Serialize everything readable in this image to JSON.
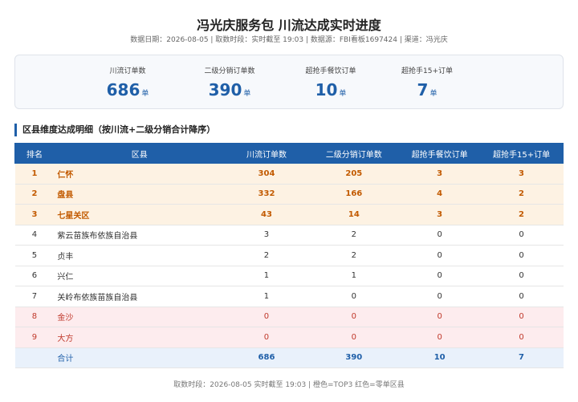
{
  "header": {
    "title": "冯光庆服务包 川流达成实时进度",
    "meta": "数据日期：2026-08-05 | 取数时段：实时截至 19:03 | 数据源：FBI看板1697424 | 渠道：冯光庆"
  },
  "kpis": [
    {
      "label": "川流订单数",
      "value": "686",
      "unit": "单"
    },
    {
      "label": "二级分销订单数",
      "value": "390",
      "unit": "单"
    },
    {
      "label": "超抢手餐饮订单",
      "value": "10",
      "unit": "单"
    },
    {
      "label": "超抢手15+订单",
      "value": "7",
      "unit": "单"
    }
  ],
  "section": {
    "title": "区县维度达成明细（按川流+二级分销合计降序）"
  },
  "table": {
    "columns": [
      "排名",
      "区县",
      "川流订单数",
      "二级分销订单数",
      "超抢手餐饮订单",
      "超抢手15+订单"
    ],
    "rows": [
      {
        "rank": "1",
        "region": "仁怀",
        "chuanliu": "304",
        "fenxiao": "205",
        "canyin": "3",
        "plus15": "3",
        "style": "top"
      },
      {
        "rank": "2",
        "region": "盘县",
        "chuanliu": "332",
        "fenxiao": "166",
        "canyin": "4",
        "plus15": "2",
        "style": "top"
      },
      {
        "rank": "3",
        "region": "七星关区",
        "chuanliu": "43",
        "fenxiao": "14",
        "canyin": "3",
        "plus15": "2",
        "style": "top"
      },
      {
        "rank": "4",
        "region": "紫云苗族布依族自治县",
        "chuanliu": "3",
        "fenxiao": "2",
        "canyin": "0",
        "plus15": "0",
        "style": "normal"
      },
      {
        "rank": "5",
        "region": "贞丰",
        "chuanliu": "2",
        "fenxiao": "2",
        "canyin": "0",
        "plus15": "0",
        "style": "normal"
      },
      {
        "rank": "6",
        "region": "兴仁",
        "chuanliu": "1",
        "fenxiao": "1",
        "canyin": "0",
        "plus15": "0",
        "style": "normal"
      },
      {
        "rank": "7",
        "region": "关岭布依族苗族自治县",
        "chuanliu": "1",
        "fenxiao": "0",
        "canyin": "0",
        "plus15": "0",
        "style": "normal"
      },
      {
        "rank": "8",
        "region": "金沙",
        "chuanliu": "0",
        "fenxiao": "0",
        "canyin": "0",
        "plus15": "0",
        "style": "zero"
      },
      {
        "rank": "9",
        "region": "大方",
        "chuanliu": "0",
        "fenxiao": "0",
        "canyin": "0",
        "plus15": "0",
        "style": "zero"
      }
    ],
    "total": {
      "label": "合计",
      "chuanliu": "686",
      "fenxiao": "390",
      "canyin": "10",
      "plus15": "7"
    }
  },
  "footer": {
    "text": "取数时段：2026-08-05 实时截至 19:03 | 橙色=TOP3 红色=零单区县"
  },
  "colors": {
    "accent": "#1f5fa8",
    "top3": "#c25a00",
    "zero": "#c0392b"
  }
}
